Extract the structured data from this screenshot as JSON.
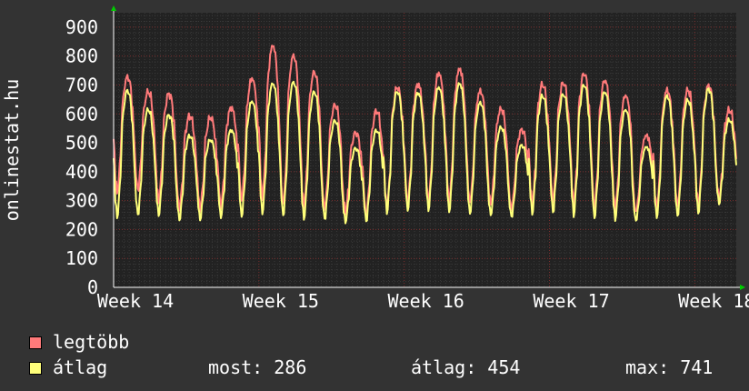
{
  "chart_data": {
    "type": "line",
    "ylabel": "onlinestat.hu",
    "ylim": [
      0,
      950
    ],
    "y_ticks": [
      0,
      100,
      200,
      300,
      400,
      500,
      600,
      700,
      800,
      900
    ],
    "x_ticks": [
      "Week 14",
      "Week 15",
      "Week 16",
      "Week 17",
      "Week 18"
    ],
    "grid": true,
    "colors": {
      "background": "#333333",
      "plot": "#222222",
      "grid_minor": "#3a3a3a",
      "grid_major": "#7a2f2f",
      "max_series": "#FF7A7A",
      "avg_series": "#FFFF7A",
      "arrow": "#00cc00"
    },
    "days": 30,
    "series": [
      {
        "name": "legtöbb",
        "color": "#FF7A7A",
        "daily_peak": [
          750,
          695,
          690,
          610,
          605,
          640,
          745,
          865,
          830,
          770,
          650,
          550,
          630,
          715,
          725,
          765,
          780,
          700,
          635,
          560,
          725,
          730,
          765,
          740,
          685,
          540,
          705,
          705,
          720,
          630
        ],
        "daily_trough": [
          320,
          330,
          290,
          265,
          265,
          275,
          295,
          300,
          275,
          270,
          265,
          255,
          240,
          265,
          285,
          285,
          290,
          285,
          280,
          265,
          280,
          290,
          275,
          270,
          265,
          255,
          265,
          270,
          275,
          300
        ]
      },
      {
        "name": "átlag",
        "color": "#FFFF7A",
        "daily_peak": [
          705,
          635,
          615,
          540,
          525,
          560,
          665,
          730,
          735,
          700,
          595,
          495,
          560,
          700,
          695,
          715,
          730,
          660,
          570,
          505,
          685,
          690,
          725,
          700,
          635,
          500,
          685,
          670,
          710,
          595
        ],
        "daily_trough": [
          235,
          245,
          245,
          230,
          232,
          240,
          240,
          250,
          240,
          230,
          230,
          222,
          225,
          255,
          262,
          262,
          255,
          248,
          245,
          240,
          250,
          255,
          245,
          235,
          230,
          225,
          235,
          240,
          250,
          285
        ]
      }
    ],
    "legend": {
      "entries": [
        "legtöbb",
        "átlag"
      ],
      "placement": "bottom-left"
    },
    "stats": {
      "current": "most: 286",
      "average": "átlag: 454",
      "max": "max: 741"
    }
  }
}
